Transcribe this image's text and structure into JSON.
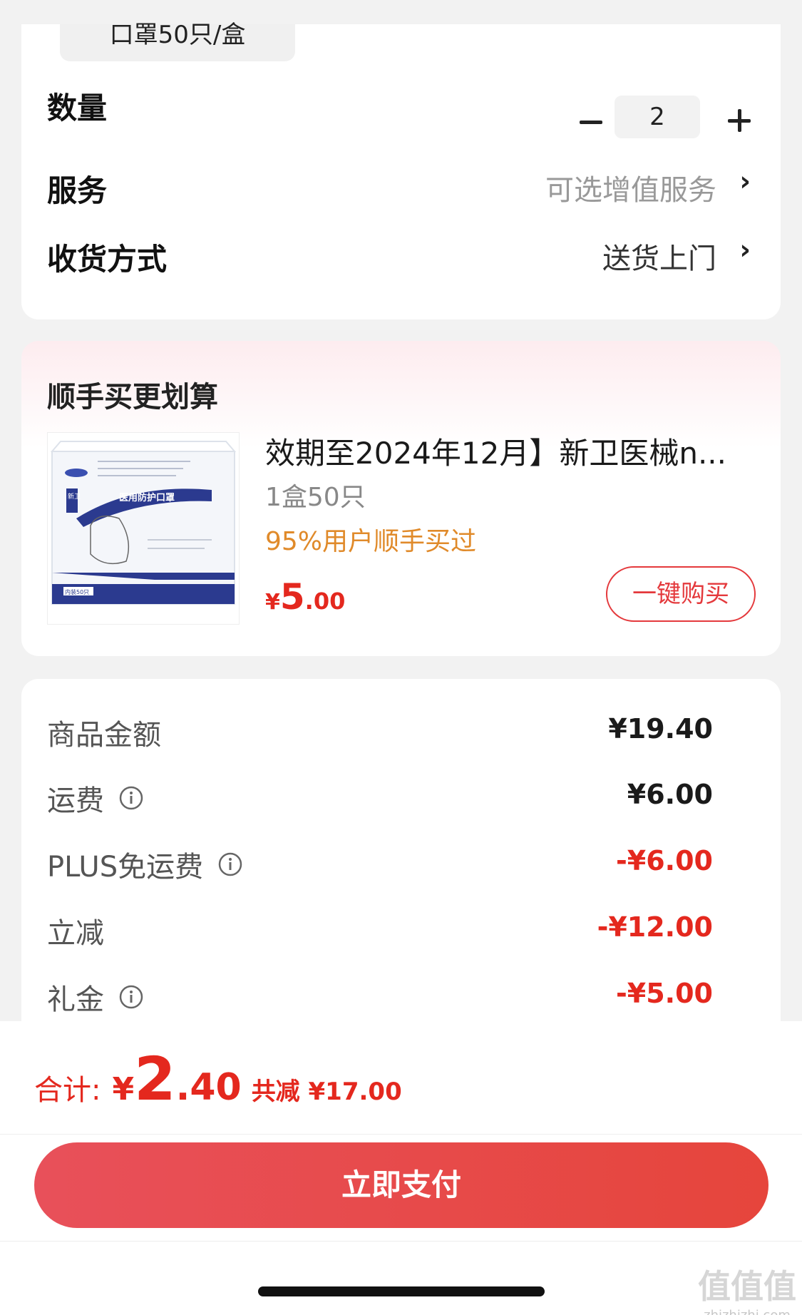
{
  "spec_chip": "口罩50只/盒",
  "rows": {
    "quantity": {
      "label": "数量",
      "value": "2"
    },
    "service": {
      "label": "服务",
      "value": "可选增值服务"
    },
    "delivery": {
      "label": "收货方式",
      "value": "送货上门"
    }
  },
  "addon": {
    "title": "顺手买更划算",
    "product_name": "效期至2024年12月】新卫医械n...",
    "product_spec": "1盒50只",
    "social_proof": "95%用户顺手买过",
    "price": {
      "currency": "¥",
      "integer": "5",
      "decimal": ".00"
    },
    "buy_button": "一键购买",
    "image_box_text": {
      "brand_tab": "新卫",
      "band_text": "医用防护口罩",
      "count_tag": "内装50只"
    }
  },
  "fees": [
    {
      "label": "商品金额",
      "value": "¥19.40",
      "info": false,
      "red": false
    },
    {
      "label": "运费",
      "value": "¥6.00",
      "info": true,
      "red": false
    },
    {
      "label": "PLUS免运费",
      "value": "-¥6.00",
      "info": true,
      "red": true
    },
    {
      "label": "立减",
      "value": "-¥12.00",
      "info": false,
      "red": true
    },
    {
      "label": "礼金",
      "value": "-¥5.00",
      "info": true,
      "red": true
    }
  ],
  "total": {
    "label": "合计:",
    "currency": "¥",
    "integer": "2",
    "decimal": ".40",
    "saved": "共减 ¥17.00"
  },
  "pay_button": "立即支付",
  "watermark": {
    "text": "zhizhizhi.com"
  },
  "colors": {
    "accent_red": "#e4281e",
    "social_orange": "#e08a2a",
    "pay_button": "#e6453c"
  }
}
